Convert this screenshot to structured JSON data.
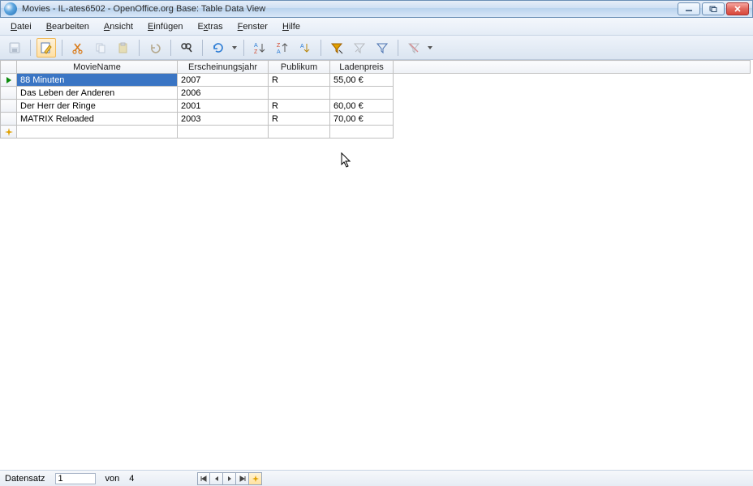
{
  "window": {
    "title": "Movies - IL-ates6502 - OpenOffice.org Base: Table Data View"
  },
  "menu": {
    "datei": "Datei",
    "bearbeiten": "Bearbeiten",
    "ansicht": "Ansicht",
    "einfuegen": "Einfügen",
    "extras": "Extras",
    "fenster": "Fenster",
    "hilfe": "Hilfe"
  },
  "columns": {
    "movie": "MovieName",
    "year": "Erscheinungsjahr",
    "pub": "Publikum",
    "price": "Ladenpreis"
  },
  "rows": [
    {
      "movie": "88 Minuten",
      "year": "2007",
      "pub": "R",
      "price": "55,00 €",
      "selected": true
    },
    {
      "movie": "Das Leben der Anderen",
      "year": "2006",
      "pub": "",
      "price": ""
    },
    {
      "movie": "Der Herr der Ringe",
      "year": "2001",
      "pub": "R",
      "price": "60,00 €"
    },
    {
      "movie": "MATRIX Reloaded",
      "year": "2003",
      "pub": "R",
      "price": "70,00 €"
    }
  ],
  "status": {
    "record_label": "Datensatz",
    "current": "1",
    "of_label": "von",
    "total": "4"
  }
}
